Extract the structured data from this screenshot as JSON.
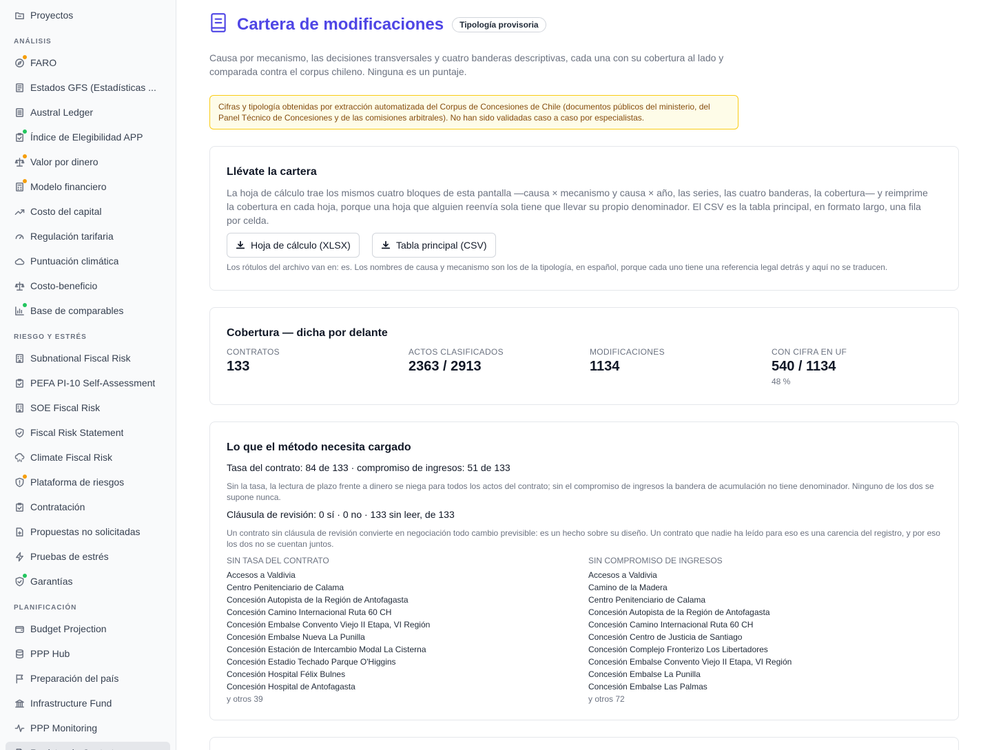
{
  "sidebar": {
    "top_item": {
      "label": "Proyectos",
      "icon": "folder-icon"
    },
    "sections": [
      {
        "header": "ANÁLISIS",
        "items": [
          {
            "label": "FARO",
            "icon": "compass-icon",
            "dot": "#f59e0b"
          },
          {
            "label": "Estados GFS (Estadísticas ...",
            "icon": "document-icon",
            "dot": null
          },
          {
            "label": "Austral Ledger",
            "icon": "ledger-icon",
            "dot": null
          },
          {
            "label": "Índice de Elegibilidad APP",
            "icon": "clipboard-check-icon",
            "dot": "#22c55e"
          },
          {
            "label": "Valor por dinero",
            "icon": "scale-icon",
            "dot": "#f59e0b"
          },
          {
            "label": "Modelo financiero",
            "icon": "calculator-icon",
            "dot": "#f59e0b"
          },
          {
            "label": "Costo del capital",
            "icon": "trending-up-icon",
            "dot": null
          },
          {
            "label": "Regulación tarifaria",
            "icon": "gauge-icon",
            "dot": null
          },
          {
            "label": "Puntuación climática",
            "icon": "cloud-icon",
            "dot": null
          },
          {
            "label": "Costo-beneficio",
            "icon": "scale-icon",
            "dot": null
          },
          {
            "label": "Base de comparables",
            "icon": "bar-chart-icon",
            "dot": "#22c55e"
          }
        ]
      },
      {
        "header": "RIESGO Y ESTRÉS",
        "items": [
          {
            "label": "Subnational Fiscal Risk",
            "icon": "building-icon",
            "dot": null
          },
          {
            "label": "PEFA PI-10 Self-Assessment",
            "icon": "clipboard-check-icon",
            "dot": null
          },
          {
            "label": "SOE Fiscal Risk",
            "icon": "building-icon",
            "dot": null
          },
          {
            "label": "Fiscal Risk Statement",
            "icon": "shield-icon",
            "dot": null
          },
          {
            "label": "Climate Fiscal Risk",
            "icon": "cloud-rain-icon",
            "dot": null
          },
          {
            "label": "Plataforma de riesgos",
            "icon": "shield-alert-icon",
            "dot": "#f59e0b"
          },
          {
            "label": "Contratación",
            "icon": "clipboard-check-icon",
            "dot": null
          },
          {
            "label": "Propuestas no solicitadas",
            "icon": "file-plus-icon",
            "dot": null
          },
          {
            "label": "Pruebas de estrés",
            "icon": "zap-icon",
            "dot": null
          },
          {
            "label": "Garantías",
            "icon": "shield-icon",
            "dot": "#22c55e"
          }
        ]
      },
      {
        "header": "PLANIFICACIÓN",
        "items": [
          {
            "label": "Budget Projection",
            "icon": "wallet-icon",
            "dot": null
          },
          {
            "label": "PPP Hub",
            "icon": "database-icon",
            "dot": null
          },
          {
            "label": "Preparación del país",
            "icon": "flag-icon",
            "dot": null
          },
          {
            "label": "Infrastructure Fund",
            "icon": "bank-icon",
            "dot": null
          },
          {
            "label": "PPP Monitoring",
            "icon": "activity-icon",
            "dot": null
          },
          {
            "label": "Registro de Contratos",
            "icon": "file-icon",
            "dot": null
          }
        ]
      }
    ]
  },
  "header": {
    "title": "Cartera de modificaciones",
    "title_icon": "book-icon",
    "badge": "Tipología provisoria",
    "intro": "Causa por mecanismo, las decisiones transversales y cuatro banderas descriptivas, cada una con su cobertura al lado y comparada contra el corpus chileno. Ninguna es un puntaje.",
    "warning": "Cifras y tipología obtenidas por extracción automatizada del Corpus de Concesiones de Chile (documentos públicos del ministerio, del Panel Técnico de Concesiones y de las comisiones arbitrales). No han sido validadas caso a caso por especialistas."
  },
  "export_card": {
    "title": "Llévate la cartera",
    "description": "La hoja de cálculo trae los mismos cuatro bloques de esta pantalla —causa × mecanismo y causa × año, las series, las cuatro banderas, la cobertura— y reimprime la cobertura en cada hoja, porque una hoja que alguien reenvía sola tiene que llevar su propio denominador. El CSV es la tabla principal, en formato largo, una fila por celda.",
    "xlsx_button": "Hoja de cálculo (XLSX)",
    "csv_button": "Tabla principal (CSV)",
    "note": "Los rótulos del archivo van en: es. Los nombres de causa y mecanismo son los de la tipología, en español, porque cada uno tiene una referencia legal detrás y aquí no se traducen."
  },
  "coverage_card": {
    "title": "Cobertura — dicha por delante",
    "stats": [
      {
        "label": "CONTRATOS",
        "value": "133",
        "sub": ""
      },
      {
        "label": "ACTOS CLASIFICADOS",
        "value": "2363 / 2913",
        "sub": ""
      },
      {
        "label": "MODIFICACIONES",
        "value": "1134",
        "sub": ""
      },
      {
        "label": "CON CIFRA EN UF",
        "value": "540 / 1134",
        "sub": "48 %"
      }
    ]
  },
  "method_card": {
    "title": "Lo que el método necesita cargado",
    "rate_line": "Tasa del contrato: 84 de 133 · compromiso de ingresos: 51 de 133",
    "rate_note": "Sin la tasa, la lectura de plazo frente a dinero se niega para todos los actos del contrato; sin el compromiso de ingresos la bandera de acumulación no tiene denominador. Ninguno de los dos se supone nunca.",
    "revision_line": "Cláusula de revisión: 0 sí · 0 no · 133 sin leer, de 133",
    "revision_note": "Un contrato sin cláusula de revisión convierte en negociación todo cambio previsible: es un hecho sobre su diseño. Un contrato que nadie ha leído para eso es una carencia del registro, y por eso los dos no se cuentan juntos.",
    "no_rate": {
      "header": "SIN TASA DEL CONTRATO",
      "items": [
        "Accesos a Valdivia",
        "Centro Penitenciario de Calama",
        "Concesión Autopista de la Región de Antofagasta",
        "Concesión Camino Internacional Ruta 60 CH",
        "Concesión Embalse Convento Viejo II Etapa, VI Región",
        "Concesión Embalse Nueva La Punilla",
        "Concesión Estación de Intercambio Modal La Cisterna",
        "Concesión Estadio Techado Parque O'Higgins",
        "Concesión Hospital Félix Bulnes",
        "Concesión Hospital de Antofagasta"
      ],
      "more": "y otros 39"
    },
    "no_revenue": {
      "header": "SIN COMPROMISO DE INGRESOS",
      "items": [
        "Accesos a Valdivia",
        "Camino de la Madera",
        "Centro Penitenciario de Calama",
        "Concesión Autopista de la Región de Antofagasta",
        "Concesión Camino Internacional Ruta 60 CH",
        "Concesión Centro de Justicia de Santiago",
        "Concesión Complejo Fronterizo Los Libertadores",
        "Concesión Embalse Convento Viejo II Etapa, VI Región",
        "Concesión Embalse La Punilla",
        "Concesión Embalse Las Palmas"
      ],
      "more": "y otros 72"
    }
  }
}
